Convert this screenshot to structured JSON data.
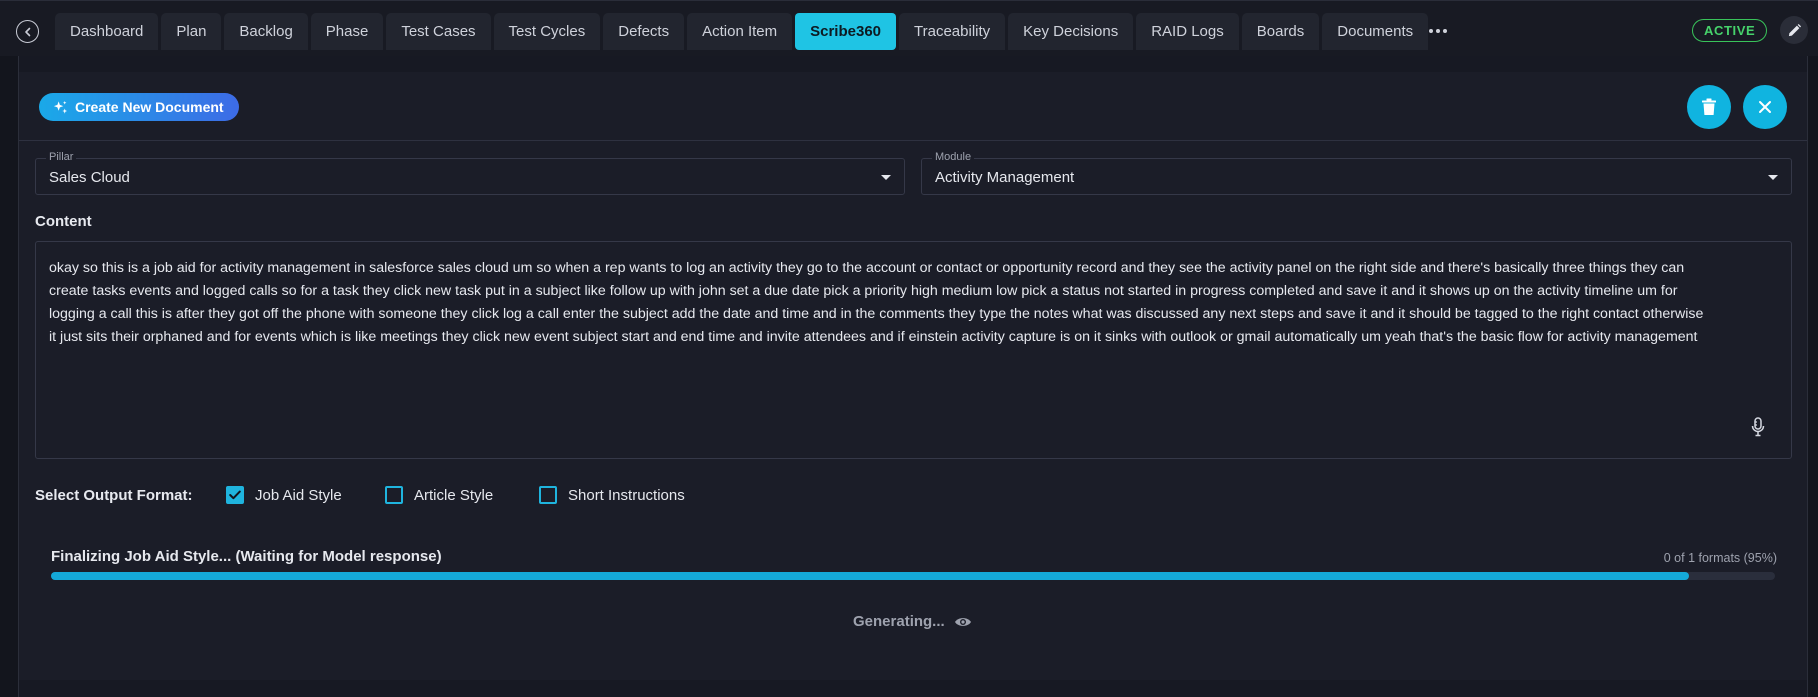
{
  "nav": {
    "tabs": [
      {
        "label": "Dashboard"
      },
      {
        "label": "Plan"
      },
      {
        "label": "Backlog"
      },
      {
        "label": "Phase"
      },
      {
        "label": "Test Cases"
      },
      {
        "label": "Test Cycles"
      },
      {
        "label": "Defects"
      },
      {
        "label": "Action Item"
      },
      {
        "label": "Scribe360",
        "active": true
      },
      {
        "label": "Traceability"
      },
      {
        "label": "Key Decisions"
      },
      {
        "label": "RAID Logs"
      },
      {
        "label": "Boards"
      },
      {
        "label": "Documents"
      }
    ],
    "status": "ACTIVE",
    "accent_color": "#1fc4e4",
    "status_color": "#46d26b"
  },
  "header": {
    "create_label": "Create New Document"
  },
  "form": {
    "pillar": {
      "label": "Pillar",
      "value": "Sales Cloud"
    },
    "module": {
      "label": "Module",
      "value": "Activity Management"
    },
    "content_label": "Content",
    "content_text": "okay so this is a job aid for activity management in salesforce sales cloud um so when a rep wants to log an activity they go to the account or contact or opportunity record and they see the activity panel on the right side and there's basically three things they can\ncreate tasks events and logged calls so for a task they click new task put in a subject like follow up with john set a due date pick a priority high medium low pick a status not started in progress completed and save it and it shows up on the activity timeline um for\nlogging a call this is after they got off the phone with someone they click log a call enter the subject add the date and time and in the comments they type the notes what was discussed any next steps and save it and it should be tagged to the right contact otherwise\nit just sits their orphaned and for events which is like meetings they click new event subject start and end time and invite attendees and if einstein activity capture is on it sinks with outlook or gmail automatically um yeah that's the basic flow for activity management"
  },
  "output_format": {
    "label": "Select Output Format:",
    "options": [
      {
        "label": "Job Aid Style",
        "checked": true
      },
      {
        "label": "Article Style",
        "checked": false
      },
      {
        "label": "Short Instructions",
        "checked": false
      }
    ]
  },
  "progress": {
    "title": "Finalizing Job Aid Style... (Waiting for Model response)",
    "count_text": "0 of 1 formats (95%)",
    "percent": 95,
    "generating_text": "Generating..."
  }
}
